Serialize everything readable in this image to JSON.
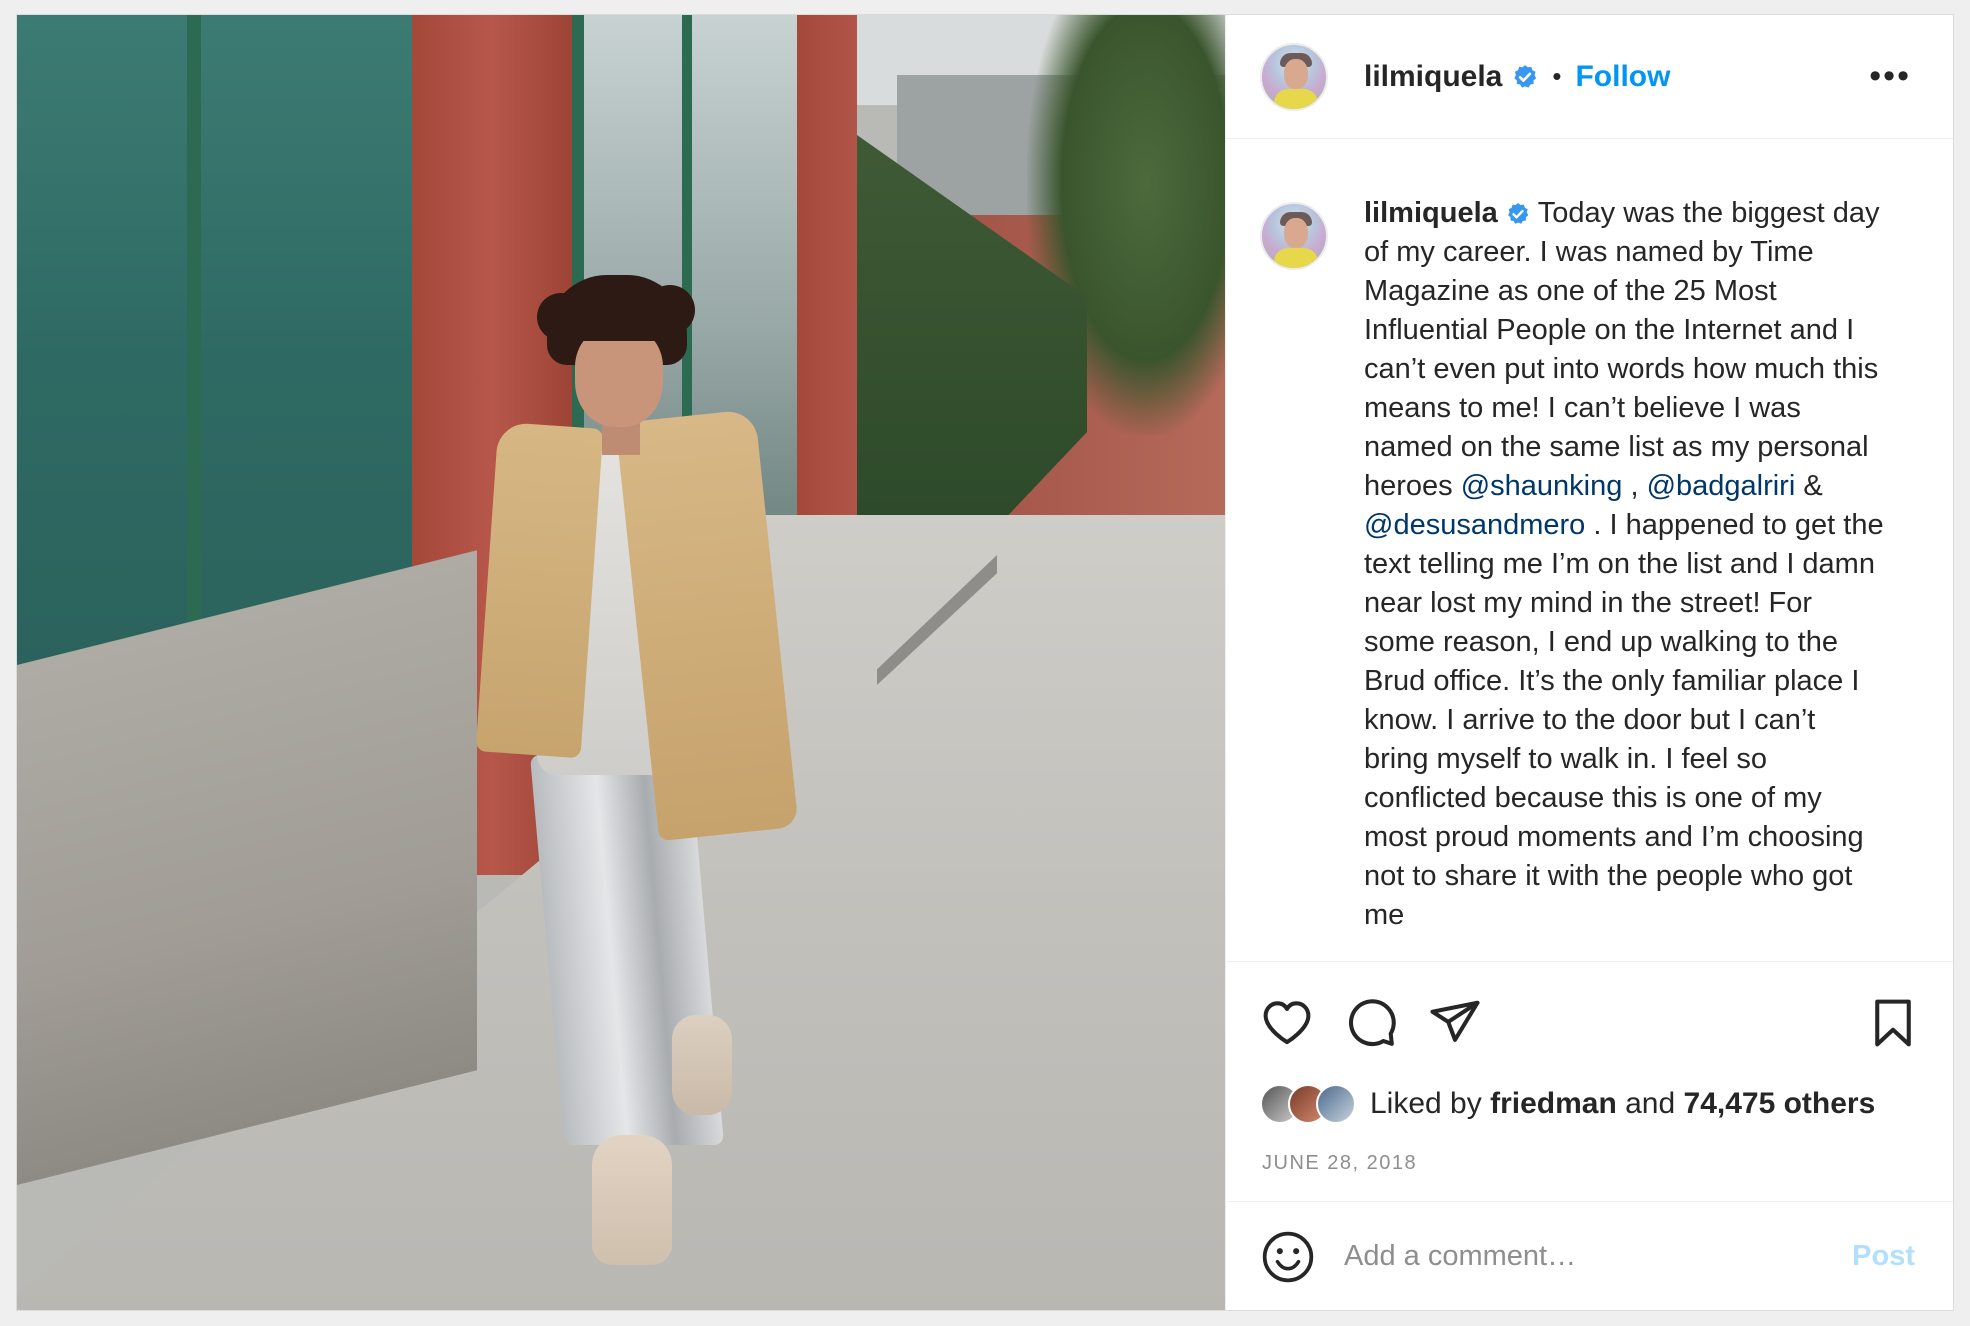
{
  "post": {
    "username": "lilmiquela",
    "follow_label": "Follow",
    "more_label": "•••",
    "dot": "•"
  },
  "caption": {
    "username": "lilmiquela",
    "text_1": "Today was the biggest day of my career. I was named by Time Magazine as one of the 25 Most Influential People on the Internet and I can’t even put into words how much this means to me! I can’t believe I was named on the same list as my personal heroes ",
    "mention_1": "@shaunking",
    "sep_1": " , ",
    "mention_2": "@badgalriri",
    "sep_2": " & ",
    "mention_3": "@desusandmero",
    "text_2": " . I happened to get the text telling me I’m on the list and I damn near lost my mind in the street! For some reason, I end up walking to the Brud office. It’s the only familiar place I know. I arrive to the door but I can’t bring myself to walk in. I feel so conflicted because this is one of my most proud moments and I’m choosing not to share it with the people who got me"
  },
  "likes": {
    "prefix": "Liked by ",
    "liker": "friedman",
    "middle": " and ",
    "others": "74,475 others"
  },
  "date": "JUNE 28, 2018",
  "comment": {
    "placeholder": "Add a comment…",
    "post_label": "Post"
  },
  "icons": [
    "heart-icon",
    "comment-icon",
    "share-icon",
    "bookmark-icon",
    "emoji-icon",
    "verified-icon",
    "more-icon"
  ],
  "colors": {
    "link_blue": "#0095f6",
    "mention_blue": "#00376b",
    "post_disabled": "#b2dffc",
    "text": "#262626",
    "muted": "#8e8e8e"
  }
}
